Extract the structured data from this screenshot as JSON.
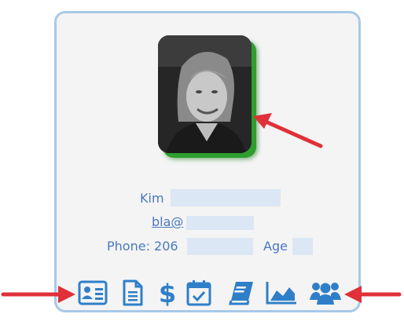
{
  "profile": {
    "first_name": "Kim",
    "email_prefix": "bla@",
    "phone_label": "Phone: 206",
    "age_label": "Age"
  },
  "toolbar": {
    "icons": [
      "contact-card-icon",
      "document-icon",
      "dollar-icon",
      "calendar-check-icon",
      "book-icon",
      "area-chart-icon",
      "group-icon"
    ]
  },
  "colors": {
    "accent": "#2f7fc8",
    "text": "#4a78c0",
    "card_border": "#a8c9e8",
    "photo_shadow": "#2e9e2e",
    "arrow": "#e0303a"
  }
}
